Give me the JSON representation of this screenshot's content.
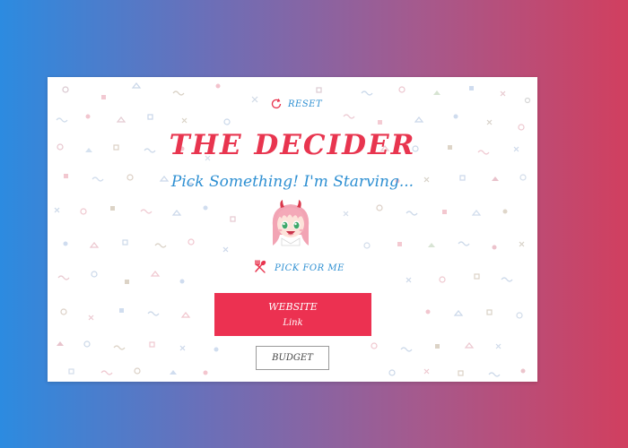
{
  "reset": {
    "icon": "refresh-icon",
    "label": "RESET"
  },
  "title": "THE DECIDER",
  "subtitle": "Pick Something! I'm Starving...",
  "avatar": {
    "icon": "anime-girl-avatar"
  },
  "pick": {
    "icon": "fork-spoon-icon",
    "label": "PICK FOR ME"
  },
  "website_button": {
    "title": "WEBSITE",
    "link_label": "Link"
  },
  "budget_button": {
    "label": "BUDGET"
  },
  "colors": {
    "gradient_left": "#2c8be0",
    "gradient_right": "#d13f5f",
    "title_red": "#e8354f",
    "accent_blue": "#2d8fd2",
    "button_red": "#ec3151"
  }
}
